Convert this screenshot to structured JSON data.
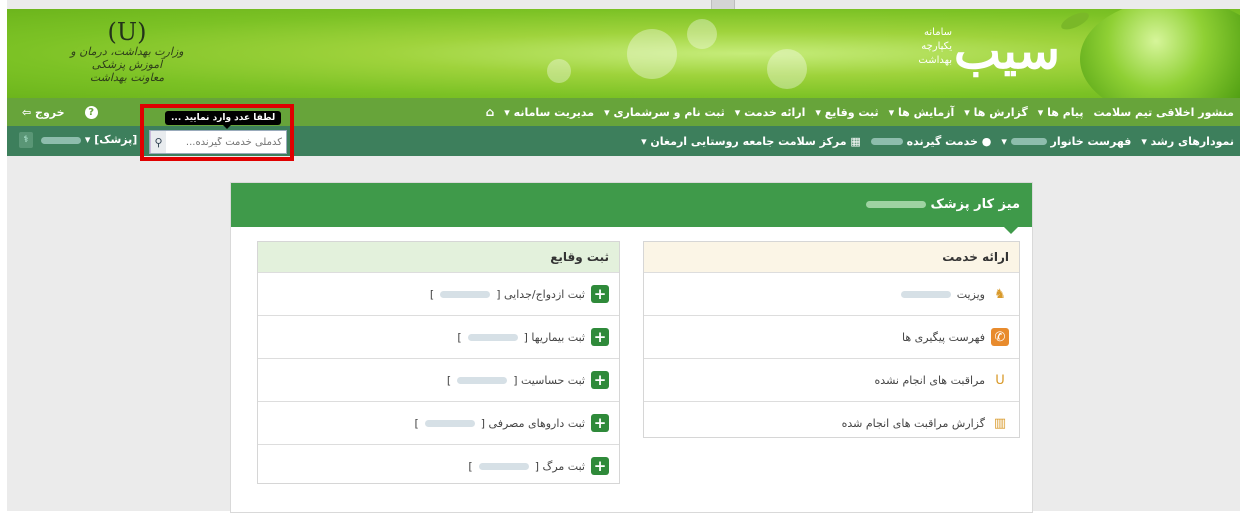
{
  "header": {
    "ministry_emblem": "(U)",
    "ministry_line1": "وزارت بهداشت، درمان و آموزش پزشکی",
    "ministry_line2": "معاونت بهداشت",
    "brand_title": "سیب",
    "brand_sub1": "سامانه",
    "brand_sub2": "یکپارچه",
    "brand_sub3": "بهداشت"
  },
  "nav1": {
    "items": [
      {
        "label": "مدیریت سامانه ▾"
      },
      {
        "label": "ثبت نام و سرشماری ▾"
      },
      {
        "label": "ارائه خدمت ▾"
      },
      {
        "label": "ثبت وقایع ▾"
      },
      {
        "label": "آزمایش ها ▾"
      },
      {
        "label": "گزارش ها ▾"
      },
      {
        "label": "پیام ها ▾"
      },
      {
        "label": "منشور اخلاقی تیم سلامت"
      }
    ],
    "exit_label": "خروج",
    "help_icon": "?"
  },
  "nav2": {
    "items": [
      {
        "label": "مرکز سلامت جامعه روستایی ارمغان ▾"
      },
      {
        "label": "خدمت گیرنده"
      },
      {
        "label": "فهرست خانوار"
      },
      {
        "label": "نمودارهای رشد ▾"
      }
    ],
    "role_label": "[پزشک] ▾"
  },
  "search": {
    "placeholder": "کدملی خدمت گیرنده...",
    "tooltip": "لطفا عدد وارد نمایید ..."
  },
  "panel": {
    "title": "میز کار پزشک",
    "service_box": {
      "title": "ارائه خدمت",
      "rows": [
        {
          "label": "ویزیت",
          "icon": "doctor-icon"
        },
        {
          "label": "فهرست پیگیری ها",
          "icon": "phone-icon"
        },
        {
          "label": "مراقبت های انجام نشده",
          "icon": "stethoscope-icon"
        },
        {
          "label": "گزارش مراقبت های انجام شده",
          "icon": "bar-chart-icon"
        }
      ]
    },
    "events_box": {
      "title": "ثبت وقایع",
      "rows": [
        {
          "label": "ثبت ازدواج/جدایی ["
        },
        {
          "label": "ثبت بیماریها ["
        },
        {
          "label": "ثبت حساسیت ["
        },
        {
          "label": "ثبت داروهای مصرفی ["
        },
        {
          "label": "ثبت مرگ ["
        }
      ],
      "close_bracket": "]"
    }
  },
  "colors": {
    "banner": "#7cc225",
    "nav1": "#67a43a",
    "nav2": "#3d7f5c",
    "panel_head": "#3f9a4a",
    "highlight": "#e00000"
  }
}
